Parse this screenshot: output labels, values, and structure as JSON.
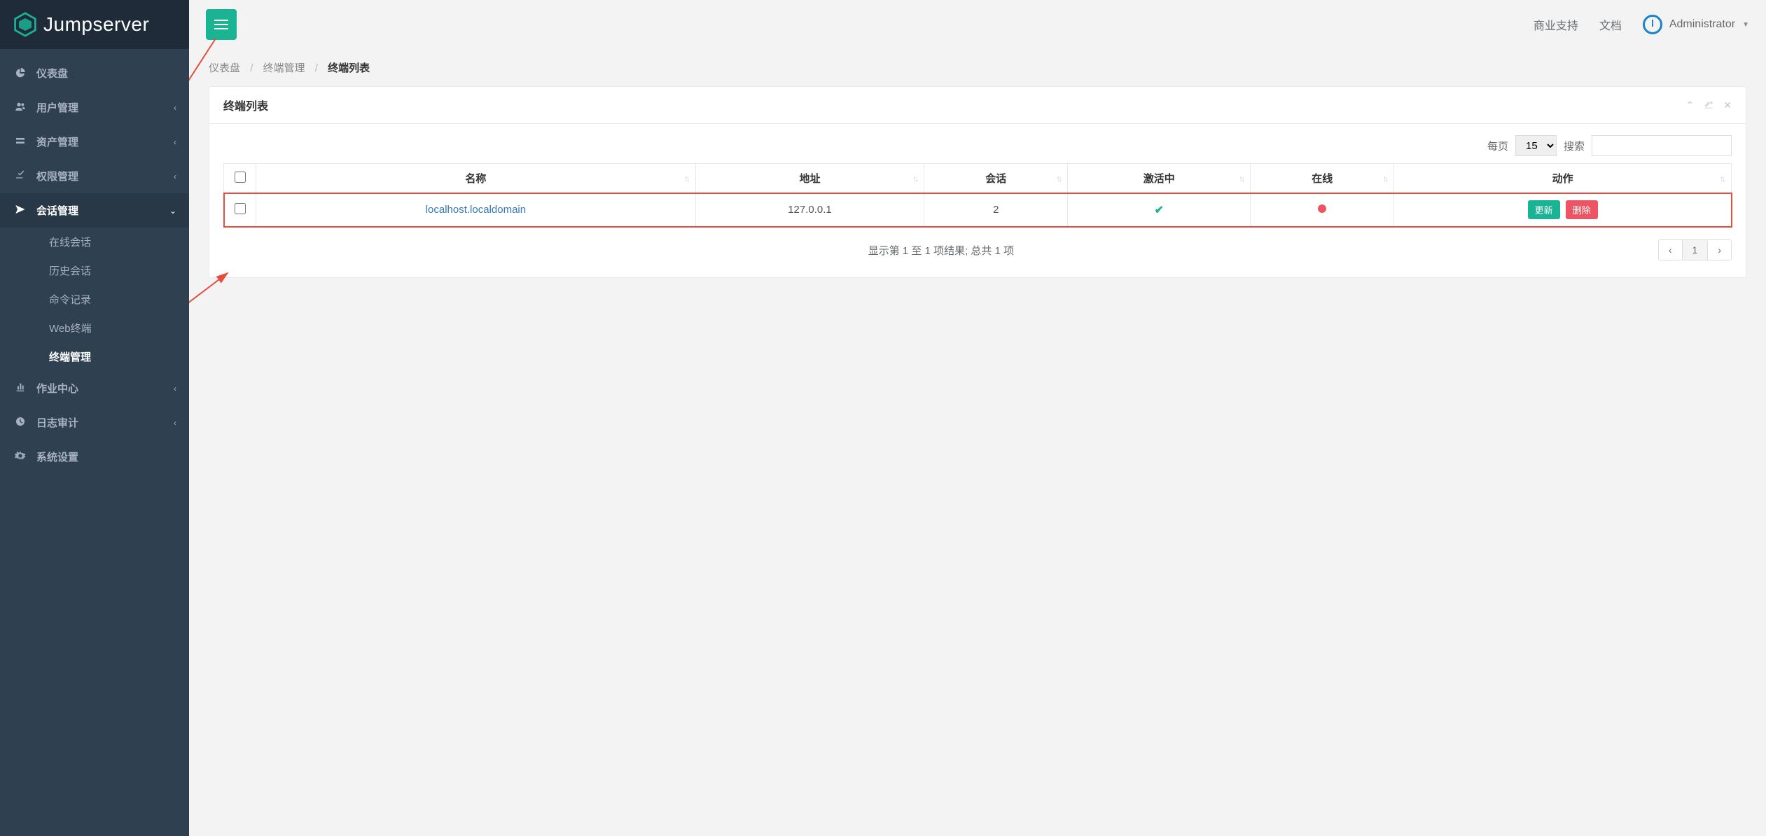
{
  "brand": {
    "name": "Jumpserver"
  },
  "topbar": {
    "links": {
      "support": "商业支持",
      "docs": "文档"
    },
    "user": "Administrator"
  },
  "sidebar": {
    "items": [
      {
        "icon": "dashboard-icon",
        "label": "仪表盘",
        "expandable": false
      },
      {
        "icon": "users-icon",
        "label": "用户管理",
        "expandable": true
      },
      {
        "icon": "assets-icon",
        "label": "资产管理",
        "expandable": true
      },
      {
        "icon": "perms-icon",
        "label": "权限管理",
        "expandable": true
      },
      {
        "icon": "sessions-icon",
        "label": "会话管理",
        "expandable": true,
        "active": true,
        "children": [
          {
            "label": "在线会话"
          },
          {
            "label": "历史会话"
          },
          {
            "label": "命令记录"
          },
          {
            "label": "Web终端"
          },
          {
            "label": "终端管理",
            "active": true
          }
        ]
      },
      {
        "icon": "jobs-icon",
        "label": "作业中心",
        "expandable": true
      },
      {
        "icon": "audit-icon",
        "label": "日志审计",
        "expandable": true
      },
      {
        "icon": "settings-icon",
        "label": "系统设置",
        "expandable": false
      }
    ]
  },
  "breadcrumb": {
    "items": [
      "仪表盘",
      "终端管理",
      "终端列表"
    ]
  },
  "panel": {
    "title": "终端列表",
    "per_page_label": "每页",
    "per_page_value": "15",
    "search_label": "搜索",
    "columns": [
      "名称",
      "地址",
      "会话",
      "激活中",
      "在线",
      "动作"
    ],
    "rows": [
      {
        "name": "localhost.localdomain",
        "addr": "127.0.0.1",
        "sessions": "2",
        "active": true,
        "online": false
      }
    ],
    "actions": {
      "update": "更新",
      "delete": "删除"
    },
    "summary": "显示第 1 至 1 项结果; 总共 1 项",
    "pager": {
      "prev": "‹",
      "page": "1",
      "next": "›"
    }
  }
}
